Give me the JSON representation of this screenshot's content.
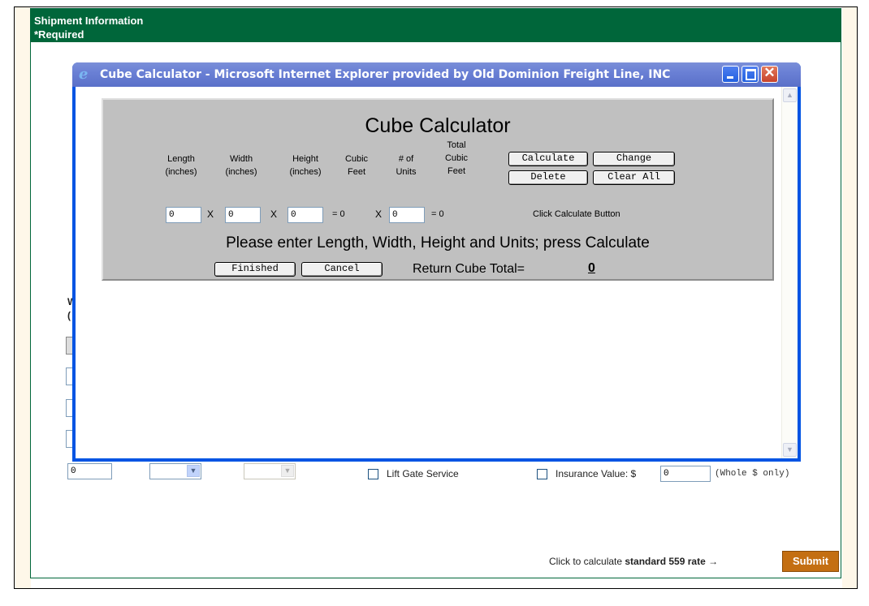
{
  "header": {
    "title": "Shipment Information",
    "required": "*Required"
  },
  "background_form": {
    "clipped_label_1": "W",
    "clipped_label_2": "(",
    "qty_value": "0",
    "lift_gate_label": "Lift Gate Service",
    "insurance_label": "Insurance Value: $",
    "insurance_value": "0",
    "insurance_note": "(Whole $ only)"
  },
  "footer": {
    "calc_prefix": "Click to calculate ",
    "calc_rate": "standard 559 rate",
    "arrow": "→",
    "submit_label": "Submit"
  },
  "popup": {
    "window_title": "Cube Calculator - Microsoft Internet Explorer provided by Old Dominion Freight Line, INC",
    "calc_title": "Cube Calculator",
    "columns": {
      "length": [
        "Length",
        "(inches)"
      ],
      "width": [
        "Width",
        "(inches)"
      ],
      "height": [
        "Height",
        "(inches)"
      ],
      "cubic_feet": [
        "Cubic",
        "Feet"
      ],
      "units": [
        "# of",
        "Units"
      ],
      "total": [
        "Total",
        "Cubic",
        "Feet"
      ]
    },
    "inputs": {
      "length": "0",
      "width": "0",
      "height": "0",
      "units": "0"
    },
    "multiply_symbol": "X",
    "cubic_result": "= 0",
    "total_result": "= 0",
    "hint": "Click Calculate Button",
    "buttons": {
      "calculate": "Calculate",
      "change": "Change",
      "delete": "Delete",
      "clear_all": "Clear All",
      "finished": "Finished",
      "cancel": "Cancel"
    },
    "instruction": "Please enter Length, Width, Height and Units; press Calculate",
    "return_label": "Return Cube Total=",
    "return_value": "0"
  },
  "colors": {
    "header_green": "#00663a",
    "submit_orange": "#c46f12",
    "calc_gray": "#c0c0c0",
    "xp_blue": "#0054e3"
  }
}
